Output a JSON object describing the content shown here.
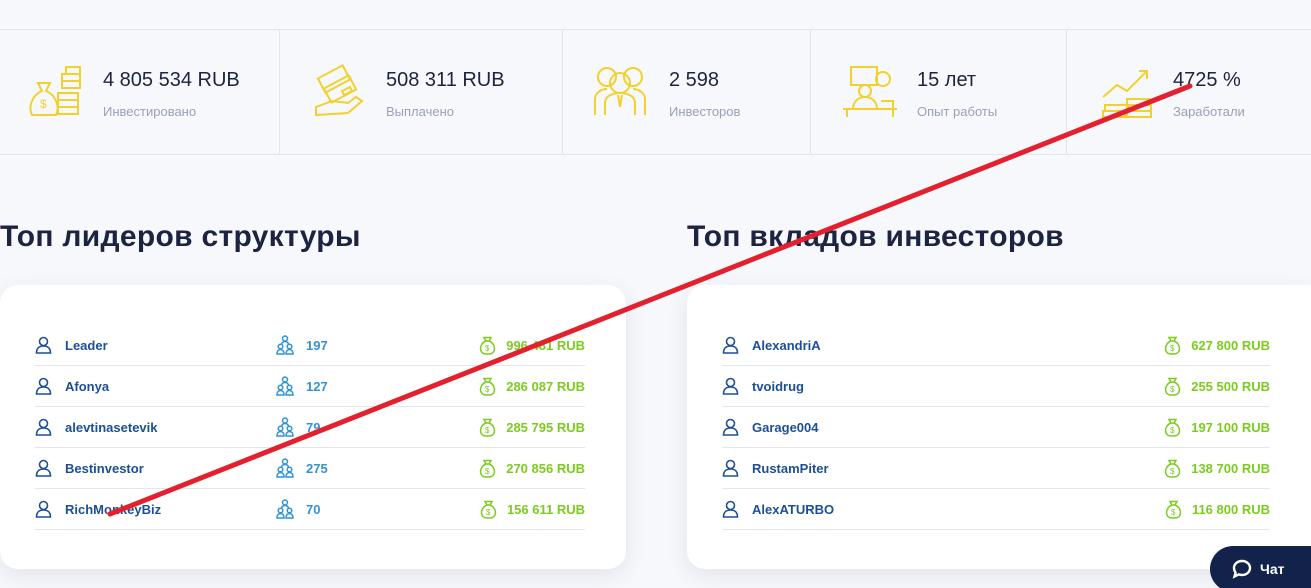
{
  "stats": [
    {
      "value": "4 805 534 RUB",
      "label": "Инвестировано",
      "icon": "money-bags-icon"
    },
    {
      "value": "508 311 RUB",
      "label": "Выплачено",
      "icon": "payout-hand-icon"
    },
    {
      "value": "2 598",
      "label": "Инвесторов",
      "icon": "investors-group-icon"
    },
    {
      "value": "15 лет",
      "label": "Опыт работы",
      "icon": "work-desk-icon"
    },
    {
      "value": "4725 %",
      "label": "Заработали",
      "icon": "growth-chart-icon"
    }
  ],
  "leaders": {
    "title": "Топ лидеров структуры",
    "rows": [
      {
        "name": "Leader",
        "count": "197",
        "amount": "996 481 RUB"
      },
      {
        "name": "Afonya",
        "count": "127",
        "amount": "286 087 RUB"
      },
      {
        "name": "alevtinasetevik",
        "count": "79",
        "amount": "285 795 RUB"
      },
      {
        "name": "Bestinvestor",
        "count": "275",
        "amount": "270 856 RUB"
      },
      {
        "name": "RichMonkeyBiz",
        "count": "70",
        "amount": "156 611 RUB"
      }
    ]
  },
  "investors": {
    "title": "Топ вкладов инвесторов",
    "rows": [
      {
        "name": "AlexandriA",
        "amount": "627 800 RUB"
      },
      {
        "name": "tvoidrug",
        "amount": "255 500 RUB"
      },
      {
        "name": "Garage004",
        "amount": "197 100 RUB"
      },
      {
        "name": "RustamPiter",
        "amount": "138 700 RUB"
      },
      {
        "name": "AlexATURBO",
        "amount": "116 800 RUB"
      }
    ]
  },
  "chat": {
    "label": "Чат",
    "icon": "chat-bubble-icon"
  },
  "colors": {
    "accent_yellow": "#f2d12e",
    "name_blue": "#1c4f96",
    "count_blue": "#2f93d6",
    "amount_green": "#7bcc1f",
    "strike_red": "#e3202e",
    "chat_bg": "#12224a"
  }
}
